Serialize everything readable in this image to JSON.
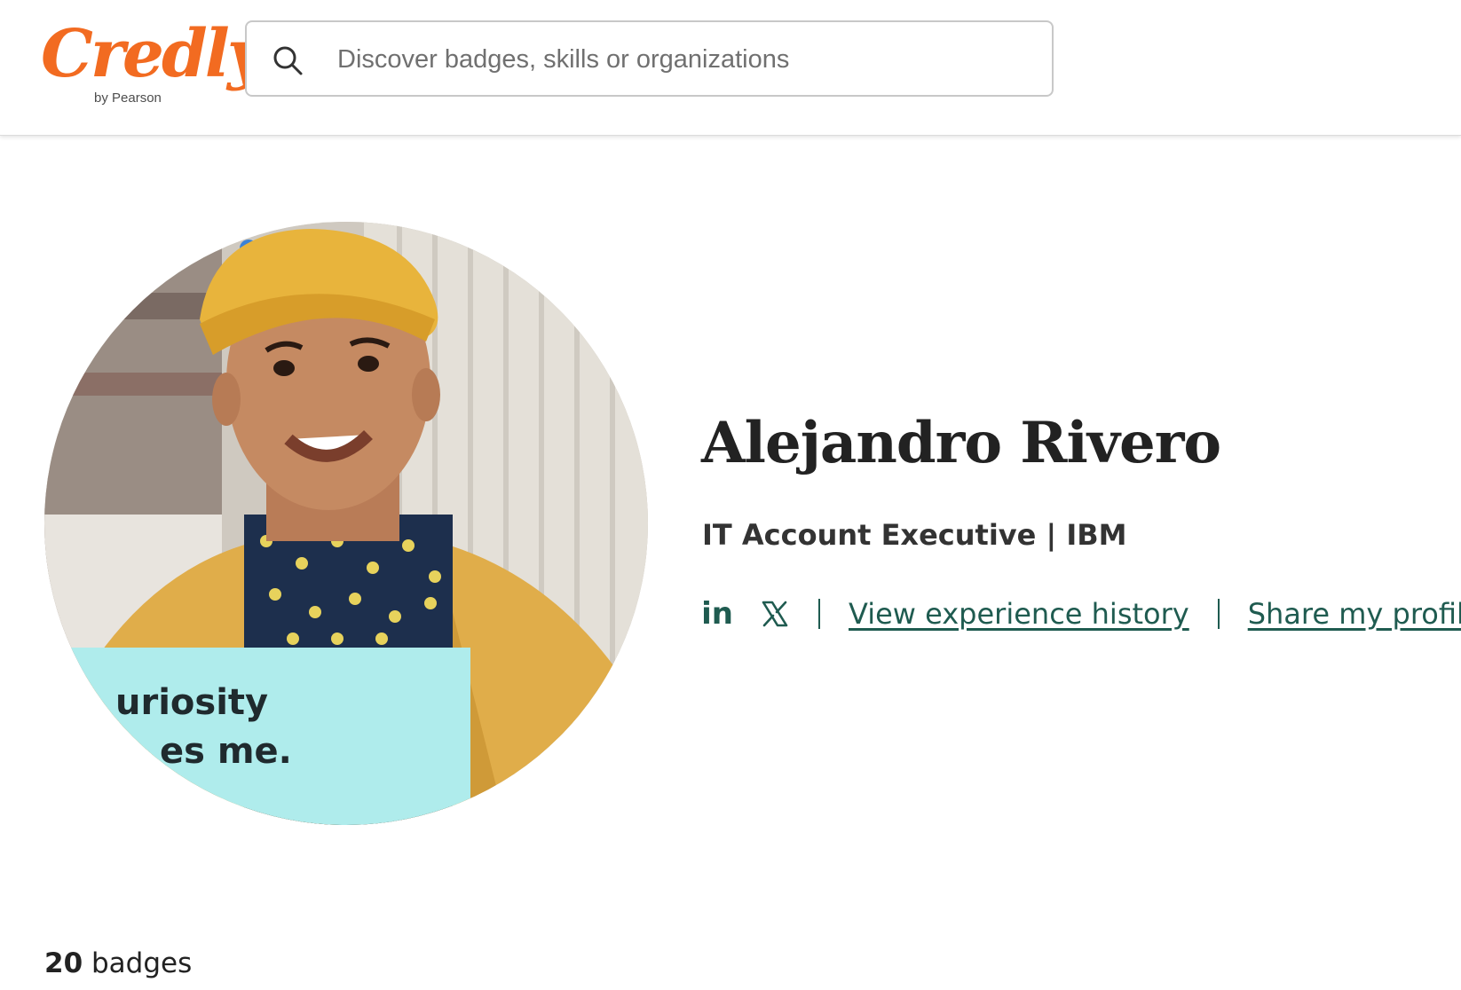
{
  "brand": {
    "name": "Credly",
    "subtitle": "by Pearson",
    "color": "#f26b21"
  },
  "search": {
    "placeholder": "Discover badges, skills or organizations",
    "value": "",
    "icon": "search-icon"
  },
  "profile": {
    "name": "Alejandro Rivero",
    "title": "IT Account Executive | IBM",
    "photo_caption_lines": [
      "uriosity",
      "es me."
    ],
    "accent_color": "#1f5b50"
  },
  "links": {
    "social": [
      {
        "icon": "linkedin-icon",
        "glyph": "in"
      },
      {
        "icon": "x-icon"
      }
    ],
    "view_history": "View experience history",
    "share_profile": "Share my profile"
  },
  "badges": {
    "count": "20",
    "label": "badges"
  }
}
